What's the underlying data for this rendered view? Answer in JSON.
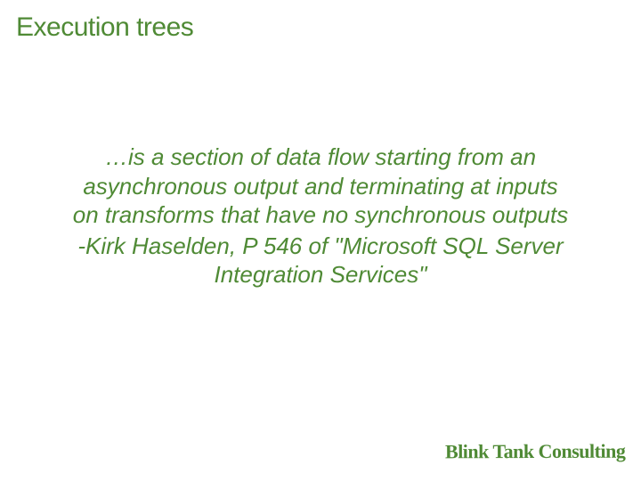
{
  "slide": {
    "title": "Execution trees",
    "quote": "…is a section of data flow starting from an\nasynchronous output and terminating at inputs\non transforms that have no synchronous outputs",
    "attribution": "-Kirk Haselden, P 546 of \"Microsoft SQL Server\nIntegration Services\"",
    "footer_logo": "Blink Tank Consulting"
  }
}
